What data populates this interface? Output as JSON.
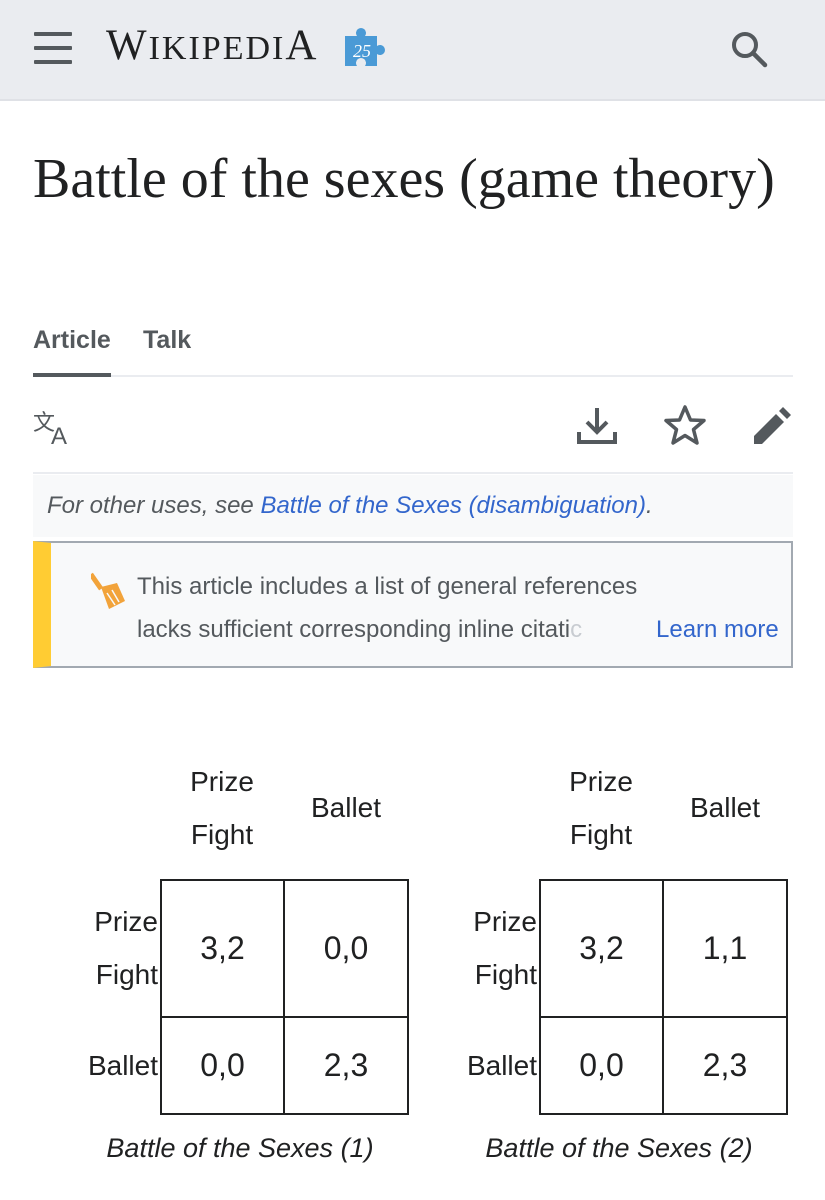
{
  "header": {
    "logo_main": "W",
    "logo_small": "IKIPEDI",
    "logo_end": "A",
    "badge": "25"
  },
  "page": {
    "title": "Battle of the sexes (game theory)"
  },
  "tabs": [
    {
      "label": "Article",
      "active": true
    },
    {
      "label": "Talk",
      "active": false
    }
  ],
  "hatnote": {
    "prefix": "For other uses, see ",
    "link": "Battle of the Sexes (disambiguation)",
    "suffix": "."
  },
  "notice": {
    "line1": "This article includes a list of general references, but it",
    "line2_visible": "lacks sufficient corresponding inline citati",
    "line2_fade": "c",
    "learn_more": "Learn more"
  },
  "matrices": [
    {
      "col_headers": [
        "Prize Fight",
        "Ballet"
      ],
      "row_headers": [
        "Prize Fight",
        "Ballet"
      ],
      "cells": [
        [
          "3,2",
          "0,0"
        ],
        [
          "0,0",
          "2,3"
        ]
      ],
      "caption": "Battle of the Sexes (1)"
    },
    {
      "col_headers": [
        "Prize Fight",
        "Ballet"
      ],
      "row_headers": [
        "Prize Fight",
        "Ballet"
      ],
      "cells": [
        [
          "3,2",
          "1,1"
        ],
        [
          "0,0",
          "2,3"
        ]
      ],
      "caption": "Battle of the Sexes (2)"
    }
  ],
  "colors": {
    "header_bg": "#eaecf0",
    "link": "#3366cc",
    "notice_accent": "#ffcc33",
    "broom": "#f2a33a",
    "puzzle": "#4a9ad6"
  },
  "icons": [
    "menu-icon",
    "search-icon",
    "language-icon",
    "download-icon",
    "star-icon",
    "edit-icon",
    "broom-icon"
  ]
}
